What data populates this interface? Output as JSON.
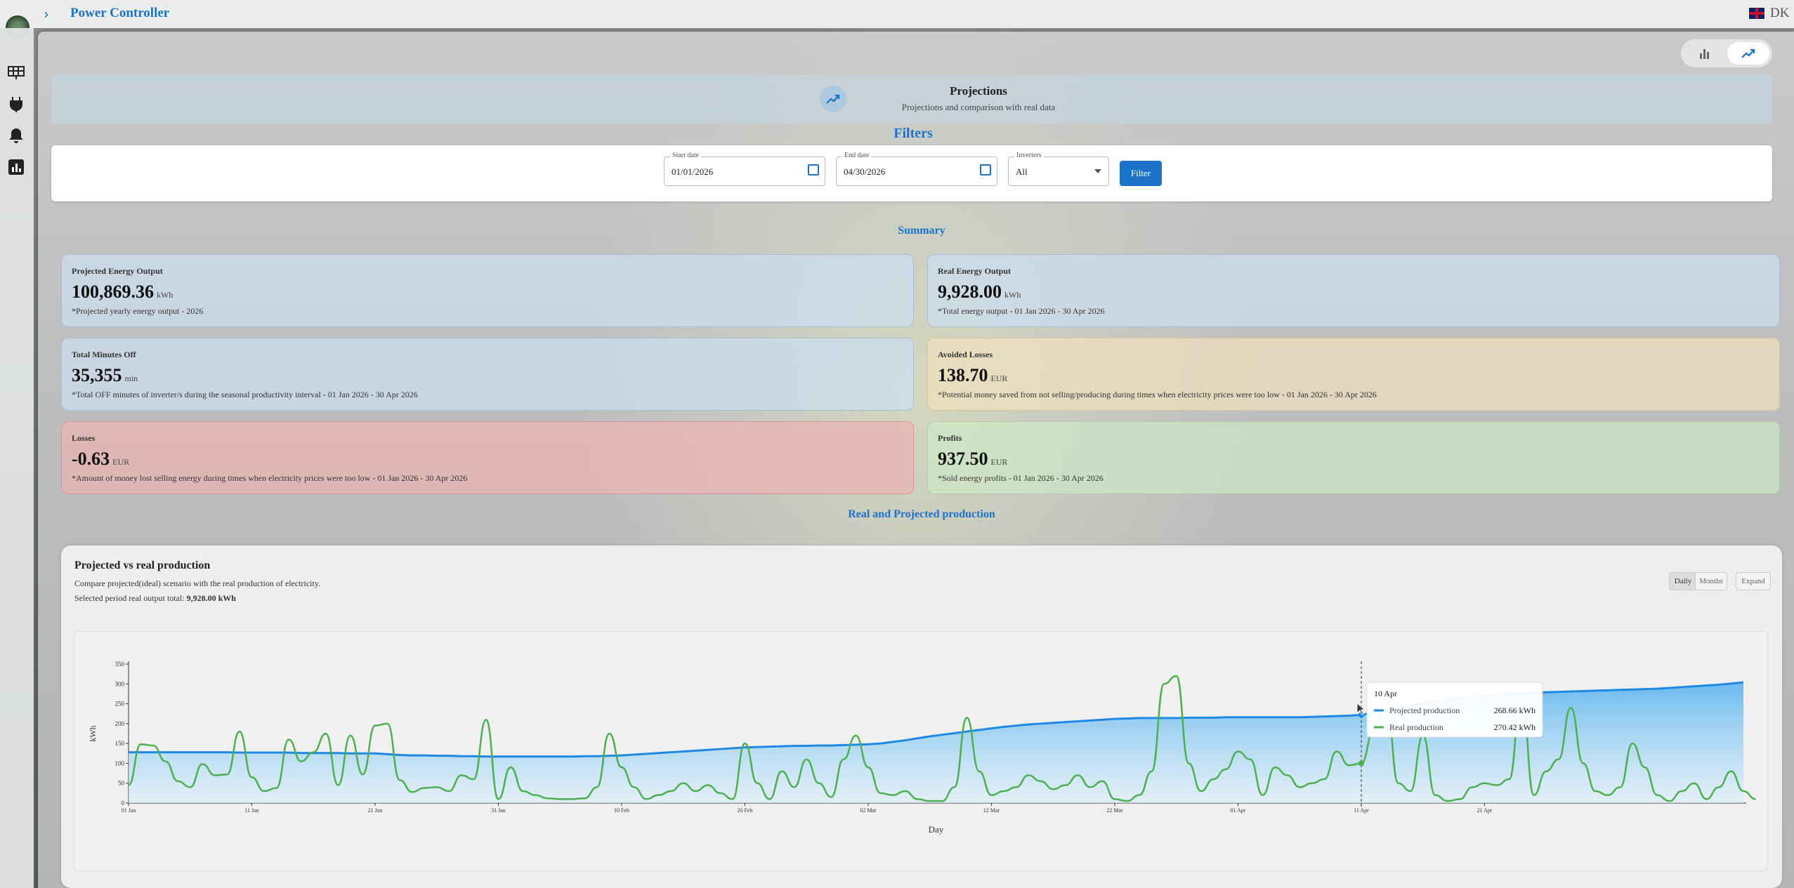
{
  "app": {
    "title": "Power Controller",
    "language": "DK"
  },
  "hero": {
    "title": "Projections",
    "subtitle": "Projections and comparison with real data"
  },
  "filters": {
    "section_title": "Filters",
    "start_label": "Start date",
    "start_value": "01/01/2026",
    "end_label": "End date",
    "end_value": "04/30/2026",
    "inverters_label": "Inverters",
    "inverters_value": "All",
    "button": "Filter"
  },
  "summary": {
    "title": "Summary",
    "cards": [
      {
        "label": "Projected Energy Output",
        "value": "100,869.36",
        "unit": "kWh",
        "note": "*Projected yearly energy output - 2026"
      },
      {
        "label": "Real Energy Output",
        "value": "9,928.00",
        "unit": "kWh",
        "note": "*Total energy output - 01 Jan 2026 - 30 Apr 2026"
      },
      {
        "label": "Total Minutes Off",
        "value": "35,355",
        "unit": "min",
        "note": "*Total OFF minutes of inverter/s during the seasonal productivity interval - 01 Jan 2026 - 30 Apr 2026"
      },
      {
        "label": "Avoided Losses",
        "value": "138.70",
        "unit": "EUR",
        "note": "*Potential money saved from not selling/producing during times when electricity prices were too low - 01 Jan 2026 - 30 Apr 2026"
      },
      {
        "label": "Losses",
        "value": "-0.63",
        "unit": "EUR",
        "note": "*Amount of money lost selling energy during times when electricity prices were too low - 01 Jan 2026 - 30 Apr 2026"
      },
      {
        "label": "Profits",
        "value": "937.50",
        "unit": "EUR",
        "note": "*Sold energy profits - 01 Jan 2026 - 30 Apr 2026"
      }
    ]
  },
  "production": {
    "section_title": "Real and Projected production",
    "card_title": "Projected vs real production",
    "card_subtitle": "Compare projected(ideal) scenario with the real production of electricity.",
    "total_prefix": "Selected period real output total:",
    "total_value": "9,928.00 kWh",
    "buttons": {
      "daily": "Daily",
      "months": "Months",
      "expand": "Expand"
    }
  },
  "tooltip": {
    "date": "10 Apr",
    "rows": [
      {
        "label": "Projected production",
        "value": "268.66 kWh"
      },
      {
        "label": "Real production",
        "value": "270.42 kWh"
      }
    ]
  },
  "icons": [
    "gear-logo-icon",
    "chevron-right-icon",
    "uk-flag-icon",
    "solar-panel-icon",
    "plug-icon",
    "bell-icon",
    "bar-chart-icon",
    "trending-up-icon",
    "calendar-icon",
    "caret-down-icon"
  ],
  "colors": {
    "accent": "#1a73c9",
    "projected": "#1e88e5",
    "real": "#4caf50"
  },
  "chart_data": {
    "type": "line",
    "xlabel": "Day",
    "ylabel": "kWh",
    "ylim": [
      0,
      350
    ],
    "yticks": [
      0,
      50,
      100,
      150,
      200,
      250,
      300,
      350
    ],
    "xtick_labels": [
      "01 Jan",
      "11 Jan",
      "21 Jan",
      "31 Jan",
      "10 Feb",
      "20 Feb",
      "02 Mar",
      "12 Mar",
      "22 Mar",
      "01 Apr",
      "11 Apr",
      "21 Apr"
    ],
    "grid": false,
    "series": [
      {
        "name": "Projected production",
        "values": [
          128,
          128,
          128,
          128,
          128,
          128,
          128,
          128,
          128,
          127,
          127,
          127,
          127,
          127,
          126,
          126,
          126,
          126,
          125,
          125,
          125,
          123,
          121,
          120,
          120,
          119,
          119,
          118,
          118,
          117,
          117,
          117,
          117,
          117,
          117,
          117,
          117,
          118,
          118,
          119,
          120,
          122,
          124,
          126,
          128,
          130,
          132,
          134,
          136,
          138,
          140,
          141,
          142,
          143,
          144,
          144,
          145,
          145,
          146,
          147,
          148,
          150,
          154,
          158,
          163,
          168,
          172,
          176,
          180,
          184,
          188,
          192,
          195,
          198,
          200,
          202,
          204,
          206,
          208,
          210,
          212,
          213,
          214,
          214,
          214,
          214,
          215,
          215,
          215,
          216,
          216,
          216,
          216,
          216,
          216,
          216,
          217,
          218,
          219,
          220,
          222,
          228,
          234,
          240,
          246,
          251,
          256,
          260,
          264,
          267,
          270,
          272,
          274,
          276,
          278,
          279,
          280,
          281,
          282,
          283,
          284,
          285,
          286,
          287,
          288,
          290,
          292,
          294,
          296,
          298,
          301,
          304
        ]
      },
      {
        "name": "Real production",
        "values": [
          45,
          148,
          145,
          105,
          55,
          40,
          98,
          70,
          72,
          180,
          65,
          30,
          38,
          160,
          105,
          128,
          175,
          45,
          170,
          72,
          195,
          200,
          58,
          28,
          38,
          40,
          30,
          70,
          60,
          210,
          10,
          90,
          30,
          20,
          12,
          10,
          10,
          12,
          40,
          175,
          90,
          40,
          10,
          20,
          30,
          50,
          30,
          45,
          25,
          10,
          150,
          50,
          10,
          80,
          40,
          110,
          50,
          15,
          110,
          170,
          90,
          25,
          20,
          30,
          10,
          5,
          5,
          40,
          215,
          80,
          20,
          30,
          40,
          70,
          55,
          35,
          45,
          70,
          40,
          55,
          10,
          5,
          20,
          80,
          300,
          320,
          100,
          30,
          60,
          85,
          130,
          110,
          20,
          90,
          70,
          40,
          50,
          60,
          130,
          95,
          100,
          180,
          265,
          50,
          30,
          170,
          20,
          5,
          10,
          40,
          50,
          45,
          60,
          270,
          20,
          80,
          110,
          240,
          100,
          30,
          20,
          40,
          150,
          90,
          20,
          5,
          30,
          50,
          10,
          40,
          80,
          30,
          10
        ]
      }
    ],
    "hover_index": 100
  }
}
